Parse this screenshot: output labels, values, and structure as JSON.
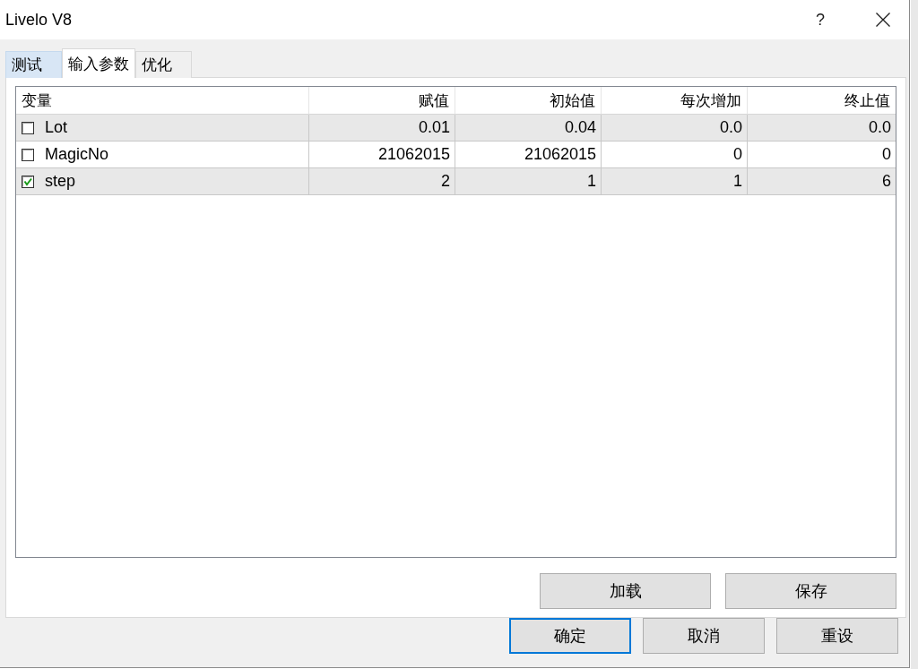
{
  "window": {
    "title": "Livelo V8",
    "help": "?"
  },
  "tabs": [
    {
      "label": "测试",
      "selected": false,
      "hovered": true
    },
    {
      "label": "输入参数",
      "selected": true,
      "hovered": false
    },
    {
      "label": "优化",
      "selected": false,
      "hovered": false
    }
  ],
  "table": {
    "columns": [
      "变量",
      "赋值",
      "初始值",
      "每次增加",
      "终止值"
    ],
    "rows": [
      {
        "checked": false,
        "cells": [
          "Lot",
          "0.01",
          "0.04",
          "0.0",
          "0.0"
        ]
      },
      {
        "checked": false,
        "cells": [
          "MagicNo",
          "21062015",
          "21062015",
          "0",
          "0"
        ]
      },
      {
        "checked": true,
        "cells": [
          "step",
          "2",
          "1",
          "1",
          "6"
        ]
      }
    ]
  },
  "panel_buttons": [
    "加载",
    "保存"
  ],
  "dialog_buttons": [
    {
      "label": "确定",
      "focused": true
    },
    {
      "label": "取消",
      "focused": false
    },
    {
      "label": "重设",
      "focused": false
    }
  ]
}
